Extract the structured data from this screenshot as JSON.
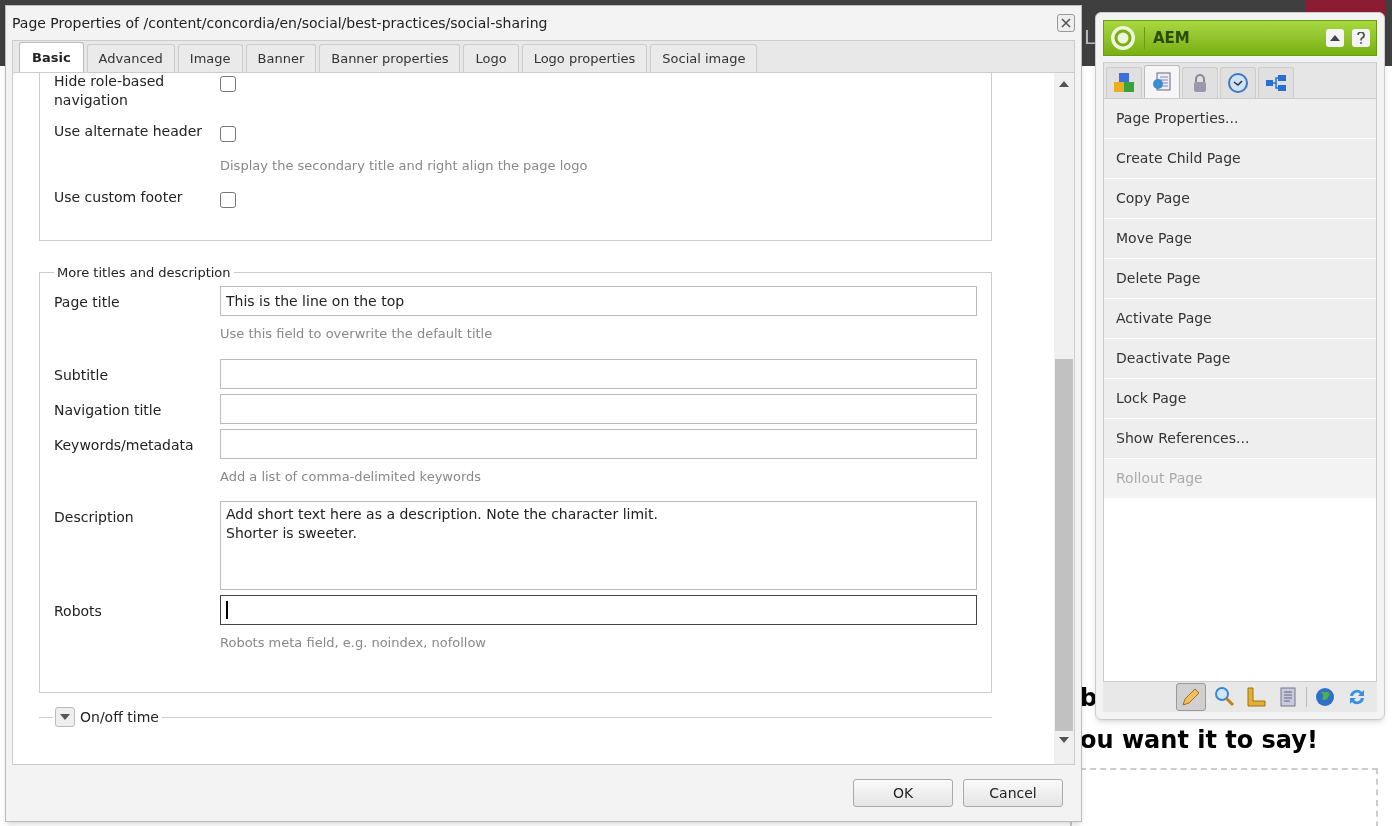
{
  "background_page": {
    "header_fragment": "L",
    "heading_fragment": "b",
    "subheading_fragment": "ou want it to say!"
  },
  "dialog": {
    "title": "Page Properties of /content/concordia/en/social/best-practices/social-sharing",
    "tabs": [
      {
        "label": "Basic",
        "selected": true
      },
      {
        "label": "Advanced",
        "selected": false
      },
      {
        "label": "Image",
        "selected": false
      },
      {
        "label": "Banner",
        "selected": false
      },
      {
        "label": "Banner properties",
        "selected": false
      },
      {
        "label": "Logo",
        "selected": false
      },
      {
        "label": "Logo properties",
        "selected": false
      },
      {
        "label": "Social image",
        "selected": false
      }
    ],
    "checkbox_fields": [
      {
        "label": "Hide role-based navigation",
        "checked": false
      },
      {
        "label": "Use alternate header",
        "checked": false,
        "hint": "Display the secondary title and right align the page logo"
      },
      {
        "label": "Use custom footer",
        "checked": false
      }
    ],
    "titles_section": {
      "legend": "More titles and description",
      "fields": [
        {
          "kind": "text",
          "label": "Page title",
          "focused": false,
          "value": "This is the line on the top",
          "hint": "Use this field to overwrite the default title"
        },
        {
          "kind": "text",
          "label": "Subtitle",
          "focused": false
        },
        {
          "kind": "text",
          "label": "Navigation title",
          "focused": false
        },
        {
          "kind": "text",
          "label": "Keywords/metadata",
          "focused": false,
          "hint": "Add a list of comma-delimited keywords"
        },
        {
          "kind": "textarea",
          "label": "Description",
          "value": "Add short text here as a description. Note the character limit.\nShorter is sweeter."
        },
        {
          "kind": "text",
          "label": "Robots",
          "focused": true,
          "hint": "Robots meta field, e.g. noindex, nofollow"
        }
      ]
    },
    "collapsed_section": {
      "legend": "On/off time",
      "expanded": false
    },
    "buttons": [
      "OK",
      "Cancel"
    ]
  },
  "sidekick": {
    "title": "AEM",
    "tabs": [
      {
        "selected": false
      },
      {
        "selected": true
      },
      {
        "selected": false
      },
      {
        "selected": false
      },
      {
        "selected": false
      }
    ],
    "menu": [
      {
        "label": "Page Properties...",
        "disabled": false
      },
      {
        "label": "Create Child Page",
        "disabled": false
      },
      {
        "label": "Copy Page",
        "disabled": false
      },
      {
        "label": "Move Page",
        "disabled": false
      },
      {
        "label": "Delete Page",
        "disabled": false
      },
      {
        "label": "Activate Page",
        "disabled": false
      },
      {
        "label": "Deactivate Page",
        "disabled": false
      },
      {
        "label": "Lock Page",
        "disabled": false
      },
      {
        "label": "Show References...",
        "disabled": false
      },
      {
        "label": "Rollout Page",
        "disabled": true
      }
    ],
    "toolbar": [
      {
        "selected": true
      },
      {
        "selected": false
      },
      {
        "selected": false
      },
      {
        "selected": false
      },
      {
        "selected": false
      },
      {
        "selected": false
      }
    ]
  }
}
